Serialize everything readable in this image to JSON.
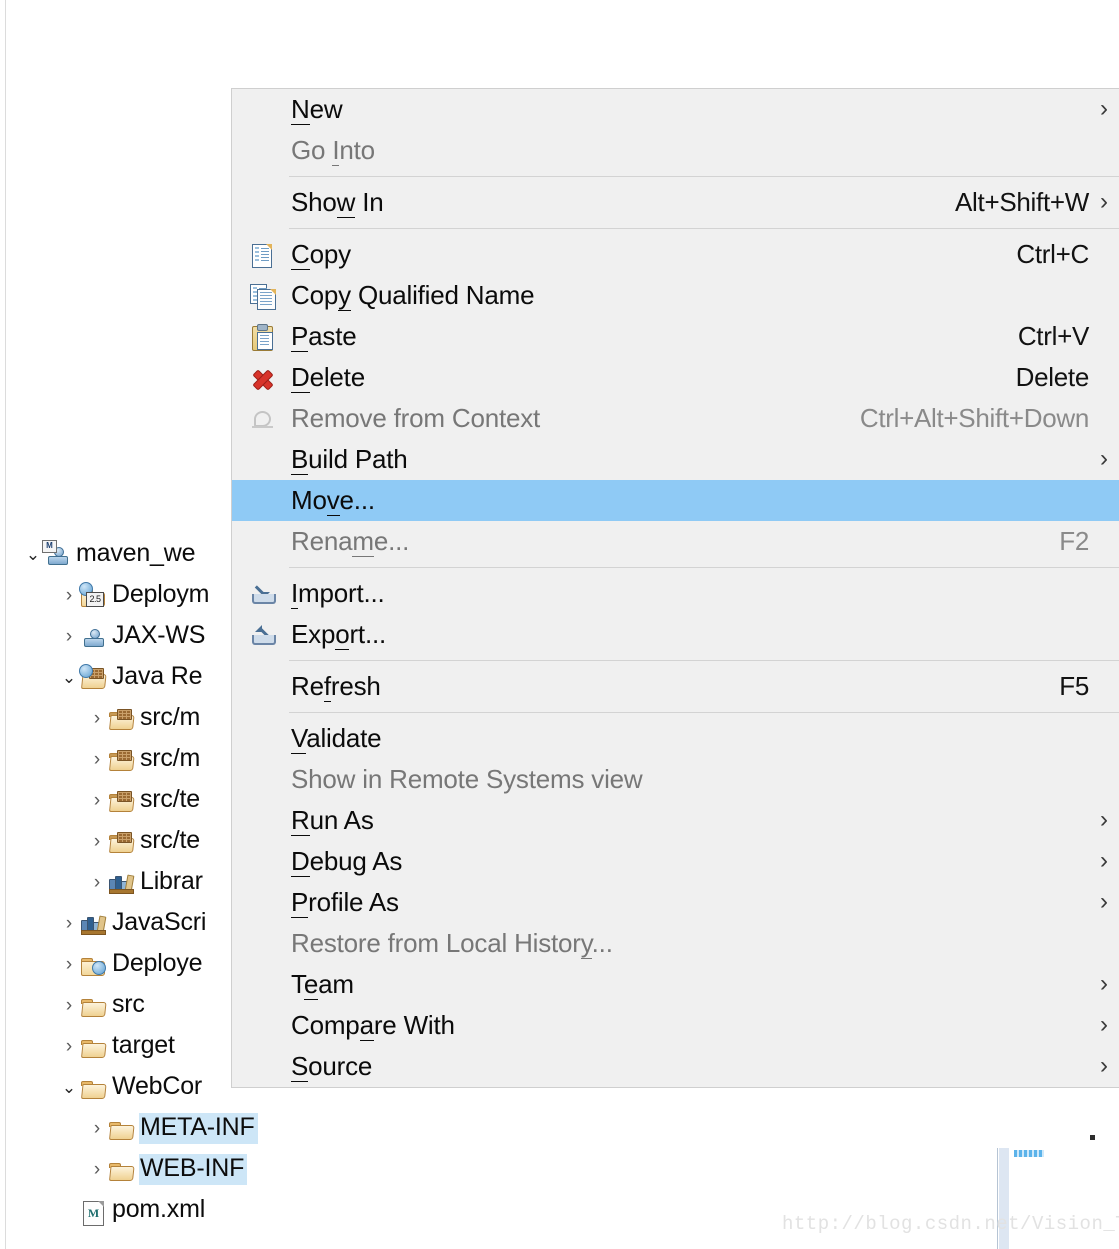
{
  "application": "Eclipse IDE - Project Explorer with context menu",
  "colors": {
    "menu_background": "#f0f0f0",
    "menu_border": "#cfcfcf",
    "menu_highlight": "#8fcaf5",
    "tree_selection": "#cde6f7",
    "text": "#0b0b0b",
    "disabled_text": "#777777",
    "separator": "#d3d3d3",
    "watermark": "#e2e2e2"
  },
  "tree": {
    "name": "project-explorer-tree",
    "items": [
      {
        "label": "maven_we",
        "icon": "maven-web-project-icon",
        "indent": 0,
        "twisty": "expanded",
        "selected": false
      },
      {
        "label": "Deploym",
        "icon": "deployment-descriptor-icon",
        "indent": 1,
        "twisty": "collapsed",
        "selected": false,
        "badge": "2.5"
      },
      {
        "label": "JAX-WS",
        "icon": "jax-ws-web-services-icon",
        "indent": 1,
        "twisty": "collapsed",
        "selected": false
      },
      {
        "label": "Java Re",
        "icon": "java-resources-icon",
        "indent": 1,
        "twisty": "expanded",
        "selected": false
      },
      {
        "label": "src/m",
        "icon": "source-folder-icon",
        "indent": 2,
        "twisty": "collapsed",
        "selected": false
      },
      {
        "label": "src/m",
        "icon": "source-folder-icon",
        "indent": 2,
        "twisty": "collapsed",
        "selected": false
      },
      {
        "label": "src/te",
        "icon": "source-folder-icon",
        "indent": 2,
        "twisty": "collapsed",
        "selected": false
      },
      {
        "label": "src/te",
        "icon": "source-folder-icon",
        "indent": 2,
        "twisty": "collapsed",
        "selected": false
      },
      {
        "label": "Librar",
        "icon": "libraries-icon",
        "indent": 2,
        "twisty": "collapsed",
        "selected": false
      },
      {
        "label": "JavaScri",
        "icon": "javascript-resources-icon",
        "indent": 1,
        "twisty": "collapsed",
        "selected": false
      },
      {
        "label": "Deploye",
        "icon": "deployed-resources-icon",
        "indent": 1,
        "twisty": "collapsed",
        "selected": false
      },
      {
        "label": "src",
        "icon": "folder-icon",
        "indent": 1,
        "twisty": "collapsed",
        "selected": false
      },
      {
        "label": "target",
        "icon": "folder-icon",
        "indent": 1,
        "twisty": "collapsed",
        "selected": false
      },
      {
        "label": "WebCor",
        "icon": "folder-icon",
        "indent": 1,
        "twisty": "expanded",
        "selected": false
      },
      {
        "label": "META-INF",
        "icon": "folder-icon",
        "indent": 2,
        "twisty": "collapsed",
        "selected": true
      },
      {
        "label": "WEB-INF",
        "icon": "folder-icon",
        "indent": 2,
        "twisty": "collapsed",
        "selected": true
      },
      {
        "label": "pom.xml",
        "icon": "maven-pom-file-icon",
        "indent": 1,
        "twisty": "none",
        "selected": false
      }
    ]
  },
  "context_menu": {
    "name": "project-context-menu",
    "items": [
      {
        "type": "item",
        "label": "New",
        "mnemonic": "N",
        "accel": "",
        "submenu": true,
        "disabled": false,
        "icon": ""
      },
      {
        "type": "item",
        "label": "Go Into",
        "mnemonic": "I",
        "accel": "",
        "submenu": false,
        "disabled": true,
        "icon": ""
      },
      {
        "type": "separator"
      },
      {
        "type": "item",
        "label": "Show In",
        "mnemonic": "w",
        "accel": "Alt+Shift+W",
        "submenu": true,
        "disabled": false,
        "icon": ""
      },
      {
        "type": "separator"
      },
      {
        "type": "item",
        "label": "Copy",
        "mnemonic": "C",
        "accel": "Ctrl+C",
        "submenu": false,
        "disabled": false,
        "icon": "copy-icon"
      },
      {
        "type": "item",
        "label": "Copy Qualified Name",
        "mnemonic": "y",
        "accel": "",
        "submenu": false,
        "disabled": false,
        "icon": "copy-qualified-name-icon"
      },
      {
        "type": "item",
        "label": "Paste",
        "mnemonic": "P",
        "accel": "Ctrl+V",
        "submenu": false,
        "disabled": false,
        "icon": "paste-icon"
      },
      {
        "type": "item",
        "label": "Delete",
        "mnemonic": "D",
        "accel": "Delete",
        "submenu": false,
        "disabled": false,
        "icon": "delete-icon"
      },
      {
        "type": "item",
        "label": "Remove from Context",
        "mnemonic": "",
        "accel": "Ctrl+Alt+Shift+Down",
        "submenu": false,
        "disabled": true,
        "icon": "remove-from-context-icon"
      },
      {
        "type": "item",
        "label": "Build Path",
        "mnemonic": "B",
        "accel": "",
        "submenu": true,
        "disabled": false,
        "icon": ""
      },
      {
        "type": "item",
        "label": "Move...",
        "mnemonic": "v",
        "accel": "",
        "submenu": false,
        "disabled": false,
        "icon": "",
        "highlighted": true
      },
      {
        "type": "item",
        "label": "Rename...",
        "mnemonic": "m",
        "accel": "F2",
        "submenu": false,
        "disabled": true,
        "icon": ""
      },
      {
        "type": "separator"
      },
      {
        "type": "item",
        "label": "Import...",
        "mnemonic": "I",
        "accel": "",
        "submenu": false,
        "disabled": false,
        "icon": "import-icon"
      },
      {
        "type": "item",
        "label": "Export...",
        "mnemonic": "o",
        "accel": "",
        "submenu": false,
        "disabled": false,
        "icon": "export-icon"
      },
      {
        "type": "separator"
      },
      {
        "type": "item",
        "label": "Refresh",
        "mnemonic": "f",
        "accel": "F5",
        "submenu": false,
        "disabled": false,
        "icon": ""
      },
      {
        "type": "separator"
      },
      {
        "type": "item",
        "label": "Validate",
        "mnemonic": "V",
        "accel": "",
        "submenu": false,
        "disabled": false,
        "icon": ""
      },
      {
        "type": "item",
        "label": "Show in Remote Systems view",
        "mnemonic": "",
        "accel": "",
        "submenu": false,
        "disabled": true,
        "icon": ""
      },
      {
        "type": "item",
        "label": "Run As",
        "mnemonic": "R",
        "accel": "",
        "submenu": true,
        "disabled": false,
        "icon": ""
      },
      {
        "type": "item",
        "label": "Debug As",
        "mnemonic": "D",
        "accel": "",
        "submenu": true,
        "disabled": false,
        "icon": ""
      },
      {
        "type": "item",
        "label": "Profile As",
        "mnemonic": "P",
        "accel": "",
        "submenu": true,
        "disabled": false,
        "icon": ""
      },
      {
        "type": "item",
        "label": "Restore from Local History...",
        "mnemonic": "y",
        "accel": "",
        "submenu": false,
        "disabled": true,
        "icon": ""
      },
      {
        "type": "item",
        "label": "Team",
        "mnemonic": "e",
        "accel": "",
        "submenu": true,
        "disabled": false,
        "icon": ""
      },
      {
        "type": "item",
        "label": "Compare With",
        "mnemonic": "a",
        "accel": "",
        "submenu": true,
        "disabled": false,
        "icon": ""
      },
      {
        "type": "item",
        "label": "Source",
        "mnemonic": "S",
        "accel": "",
        "submenu": true,
        "disabled": false,
        "icon": ""
      }
    ]
  },
  "watermark": {
    "text": "http://blog.csdn.net/Vision_Tung"
  }
}
